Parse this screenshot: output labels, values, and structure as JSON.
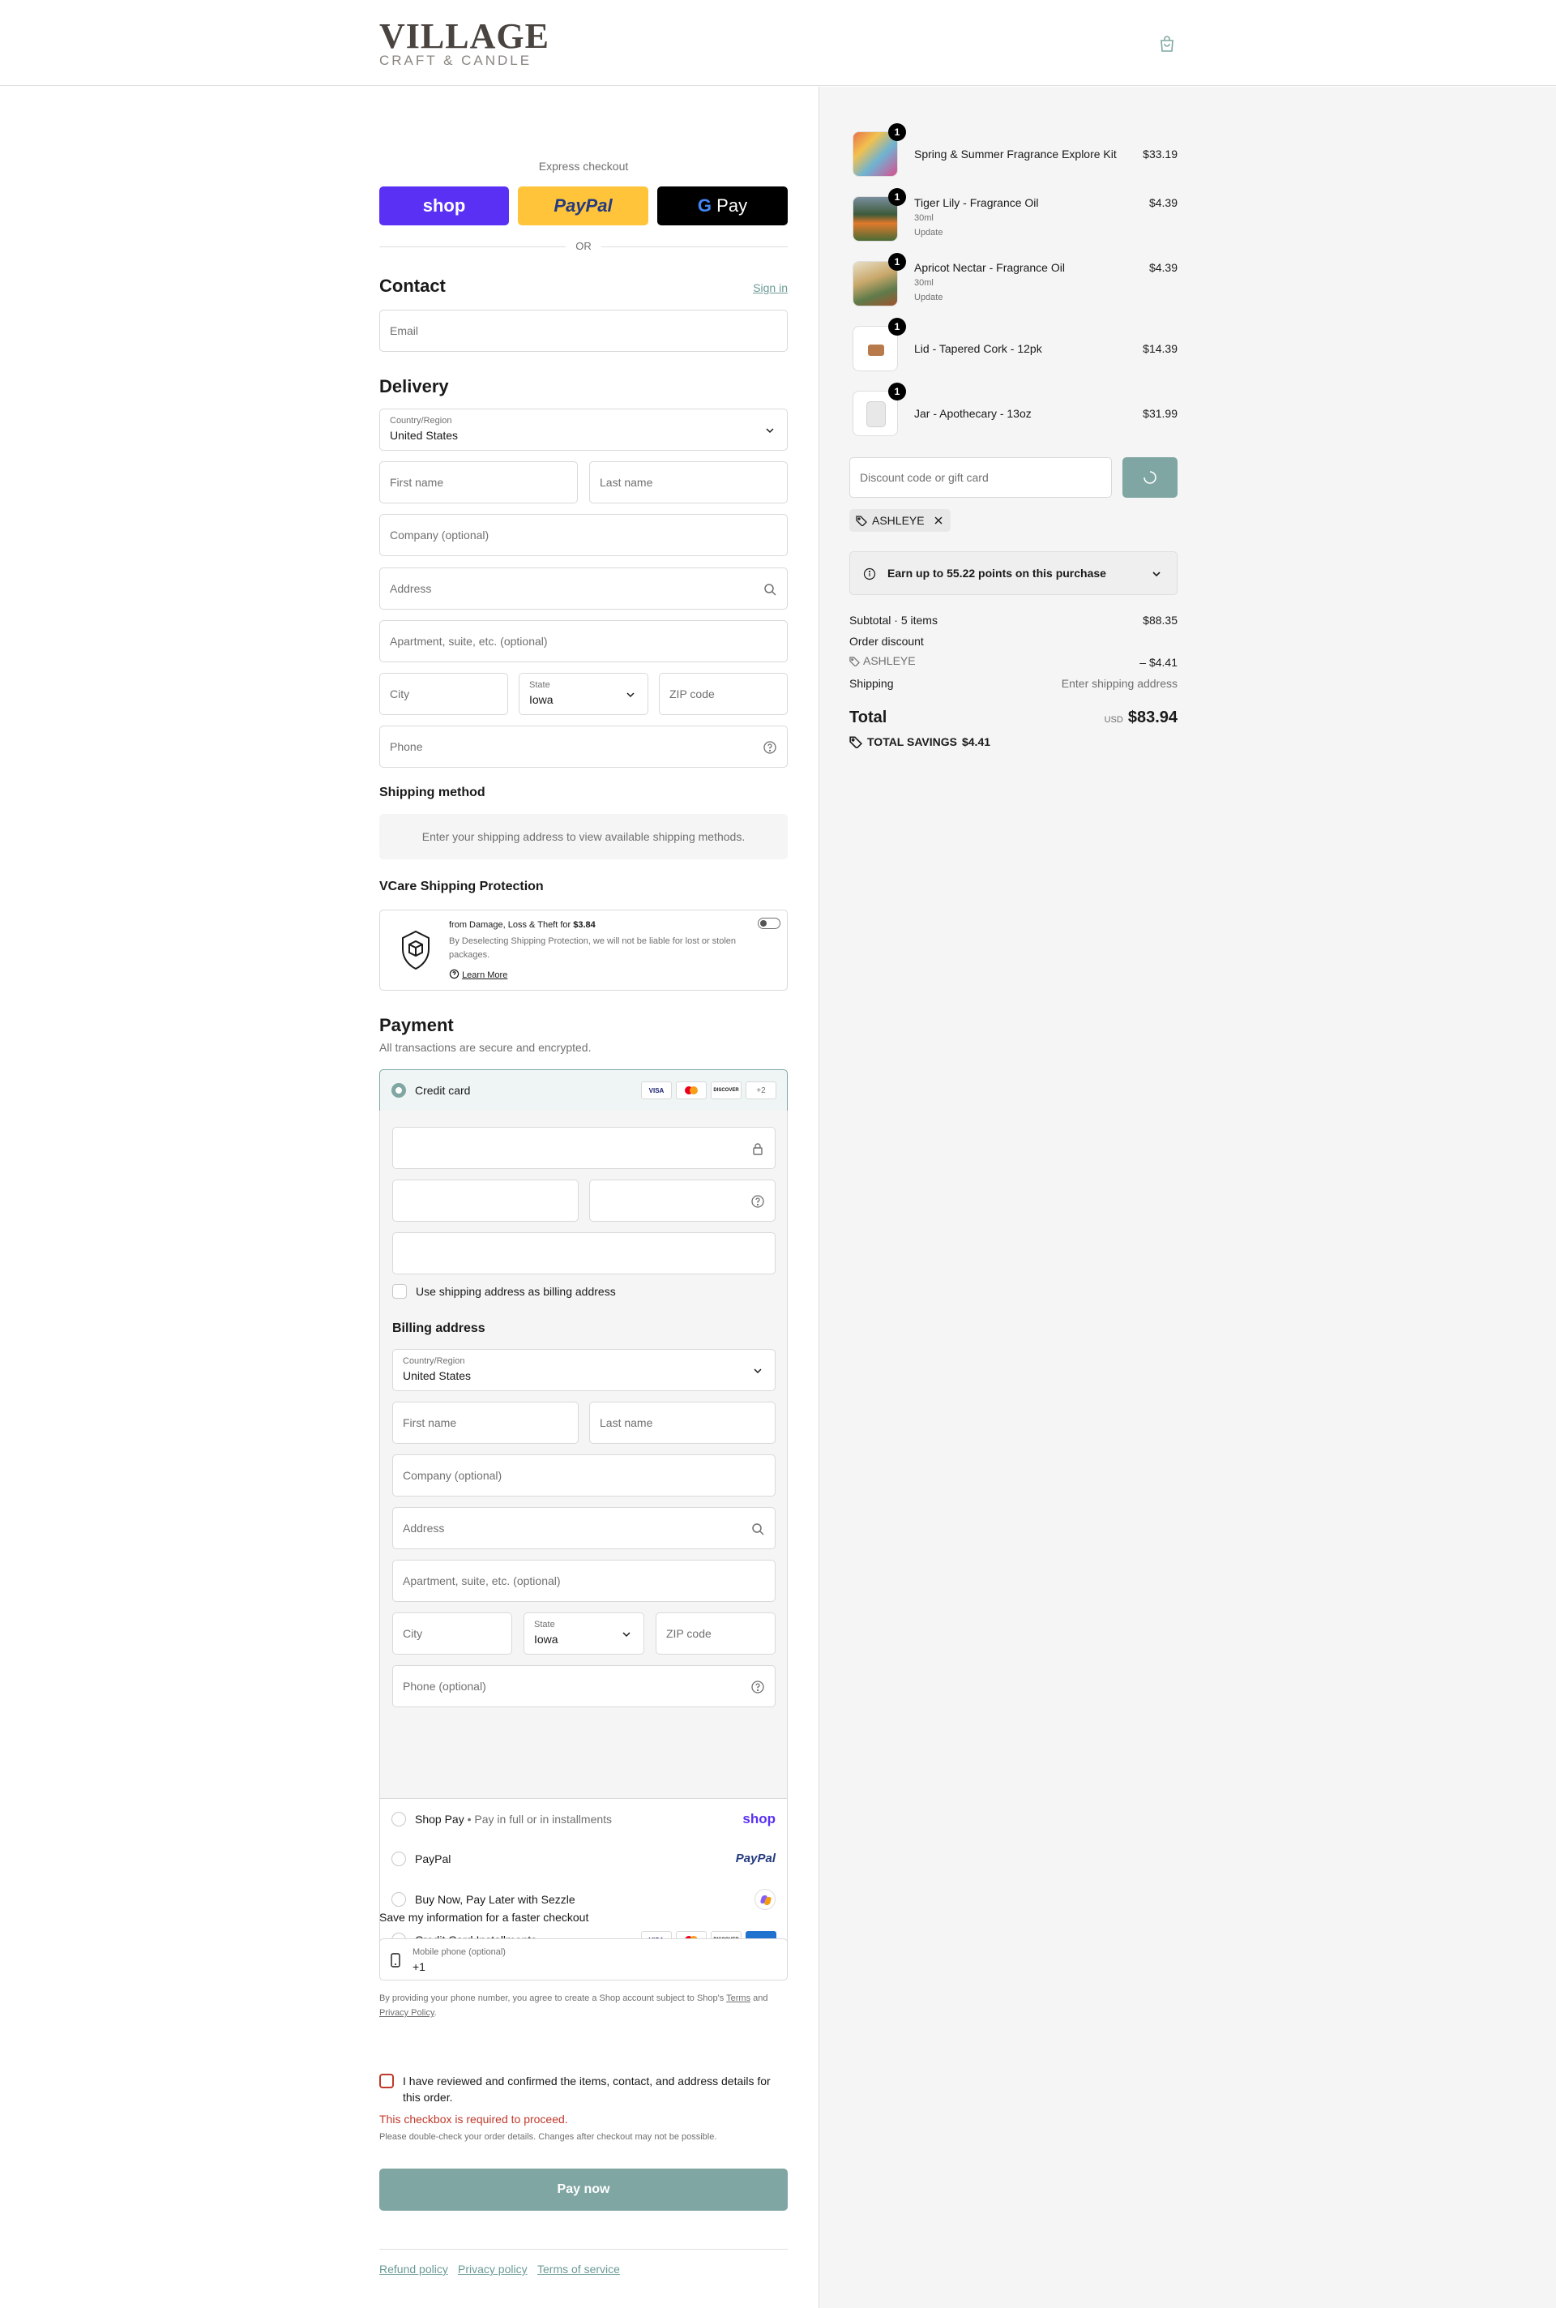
{
  "brand": {
    "name": "VILLAGE",
    "tagline": "CRAFT & CANDLE"
  },
  "express": {
    "title": "Express checkout",
    "shop_label": "shop",
    "paypal_label": "PayPal",
    "gpay_label": "Pay",
    "or_label": "OR"
  },
  "contact": {
    "title": "Contact",
    "sign_in": "Sign in",
    "email_placeholder": "Email"
  },
  "delivery": {
    "title": "Delivery",
    "country_label": "Country/Region",
    "country_value": "United States",
    "first_name": "First name",
    "last_name": "Last name",
    "company": "Company (optional)",
    "address": "Address",
    "apartment": "Apartment, suite, etc. (optional)",
    "city": "City",
    "state_label": "State",
    "state_value": "Iowa",
    "zip": "ZIP code",
    "phone": "Phone"
  },
  "shipping_method": {
    "title": "Shipping method",
    "message": "Enter your shipping address to view available shipping methods."
  },
  "protection": {
    "title": "VCare Shipping Protection",
    "line1_prefix": "from Damage, Loss & Theft for ",
    "price": "$3.84",
    "line2": "By Deselecting Shipping Protection, we will not be liable for lost or stolen packages.",
    "learn_more": "Learn More"
  },
  "payment": {
    "title": "Payment",
    "subtitle": "All transactions are secure and encrypted.",
    "credit_card_label": "Credit card",
    "card_more": "+2",
    "visa": "VISA",
    "discover": "DISCOVER",
    "use_shipping_billing": "Use shipping address as billing address",
    "billing_title": "Billing address",
    "billing": {
      "country_label": "Country/Region",
      "country_value": "United States",
      "first_name": "First name",
      "last_name": "Last name",
      "company": "Company (optional)",
      "address": "Address",
      "apartment": "Apartment, suite, etc. (optional)",
      "city": "City",
      "state_label": "State",
      "state_value": "Iowa",
      "zip": "ZIP code",
      "phone": "Phone (optional)"
    },
    "options": [
      {
        "label": "Shop Pay",
        "sub": "Pay in full or in installments",
        "brand": "shop"
      },
      {
        "label": "PayPal",
        "brand": "PayPal"
      },
      {
        "label": "Buy Now, Pay Later with Sezzle"
      },
      {
        "label": "Credit Card Installments"
      }
    ]
  },
  "save_info": {
    "title": "Save my information for a faster checkout",
    "mobile_label": "Mobile phone (optional)",
    "mobile_value": "+1",
    "legal_prefix": "By providing your phone number, you agree to create a Shop account subject to Shop's ",
    "terms": "Terms",
    "and": " and ",
    "privacy": "Privacy Policy",
    "period": "."
  },
  "confirm": {
    "text": "I have reviewed and confirmed the items, contact, and address details for this order.",
    "error": "This checkbox is required to proceed.",
    "note": "Please double-check your order details. Changes after checkout may not be possible."
  },
  "pay_now": "Pay now",
  "footer_links": [
    "Refund policy",
    "Privacy policy",
    "Terms of service"
  ],
  "items": [
    {
      "name": "Spring & Summer Fragrance Explore Kit",
      "qty": "1",
      "price": "$33.19",
      "variant": "",
      "update": ""
    },
    {
      "name": "Tiger Lily - Fragrance Oil",
      "qty": "1",
      "price": "$4.39",
      "variant": "30ml",
      "update": "Update"
    },
    {
      "name": "Apricot Nectar - Fragrance Oil",
      "qty": "1",
      "price": "$4.39",
      "variant": "30ml",
      "update": "Update"
    },
    {
      "name": "Lid - Tapered Cork - 12pk",
      "qty": "1",
      "price": "$14.39",
      "variant": "",
      "update": ""
    },
    {
      "name": "Jar - Apothecary - 13oz",
      "qty": "1",
      "price": "$31.99",
      "variant": "",
      "update": ""
    }
  ],
  "discount": {
    "placeholder": "Discount code or gift card",
    "applied_code": "ASHLEYE"
  },
  "points": {
    "text": "Earn up to 55.22 points on this purchase"
  },
  "totals": {
    "subtotal_label": "Subtotal · 5 items",
    "subtotal_value": "$88.35",
    "order_discount_label": "Order discount",
    "discount_code": "ASHLEYE",
    "discount_value": "– $4.41",
    "shipping_label": "Shipping",
    "shipping_value": "Enter shipping address",
    "total_label": "Total",
    "currency": "USD",
    "total_value": "$83.94",
    "savings_label": "TOTAL SAVINGS",
    "savings_value": "$4.41"
  },
  "colors": {
    "accent": "#7fa6a3",
    "shop": "#5a31f4",
    "paypal": "#ffc439",
    "error": "#c0392b"
  }
}
